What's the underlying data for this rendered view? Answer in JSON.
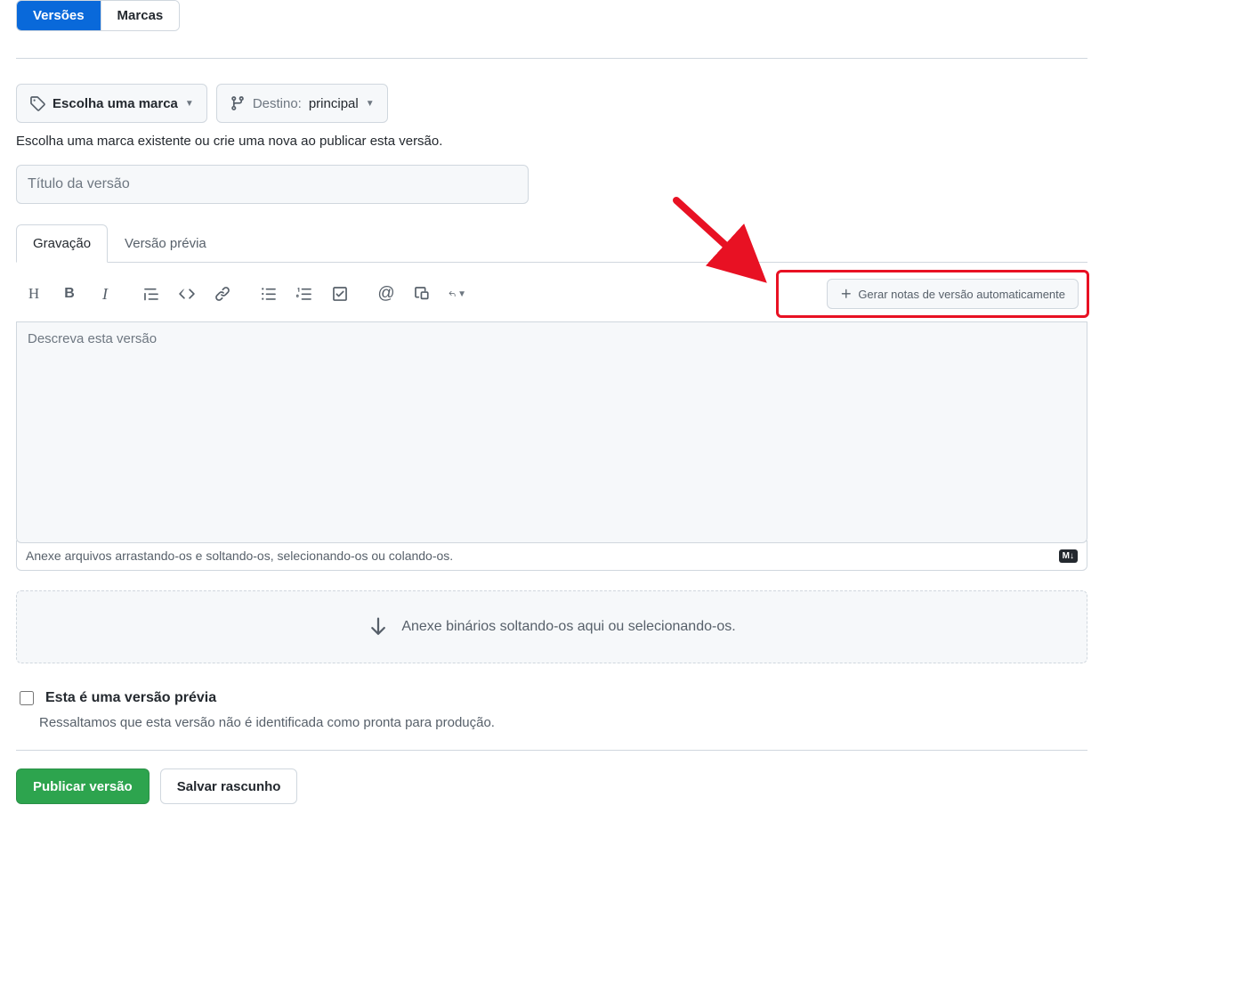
{
  "nav": {
    "versions": "Versões",
    "tags": "Marcas"
  },
  "selectors": {
    "choose_tag": "Escolha uma marca",
    "target_label": "Destino:",
    "target_value": "principal",
    "help": "Escolha uma marca existente ou crie uma nova ao publicar esta versão."
  },
  "title_placeholder": "Título da versão",
  "editor": {
    "write": "Gravação",
    "preview": "Versão prévia",
    "generate_notes": "Gerar notas de versão automaticamente"
  },
  "description_placeholder": "Descreva esta versão",
  "attach_hint": "Anexe arquivos arrastando-os e soltando-os, selecionando-os ou colando-os.",
  "md_badge": "M↓",
  "binaries_hint": "Anexe binários soltando-os aqui ou selecionando-os.",
  "prerelease": {
    "label": "Esta é uma versão prévia",
    "desc": "Ressaltamos que esta versão não é identificada como pronta para produção."
  },
  "actions": {
    "publish": "Publicar versão",
    "save_draft": "Salvar rascunho"
  },
  "toolbar_icons": {
    "heading": "H",
    "bold": "B",
    "italic": "I",
    "quote": "quote",
    "code": "code",
    "link": "link",
    "ul": "ul",
    "ol": "ol",
    "task": "task",
    "mention": "@",
    "crossref": "crossref",
    "reply": "reply"
  }
}
